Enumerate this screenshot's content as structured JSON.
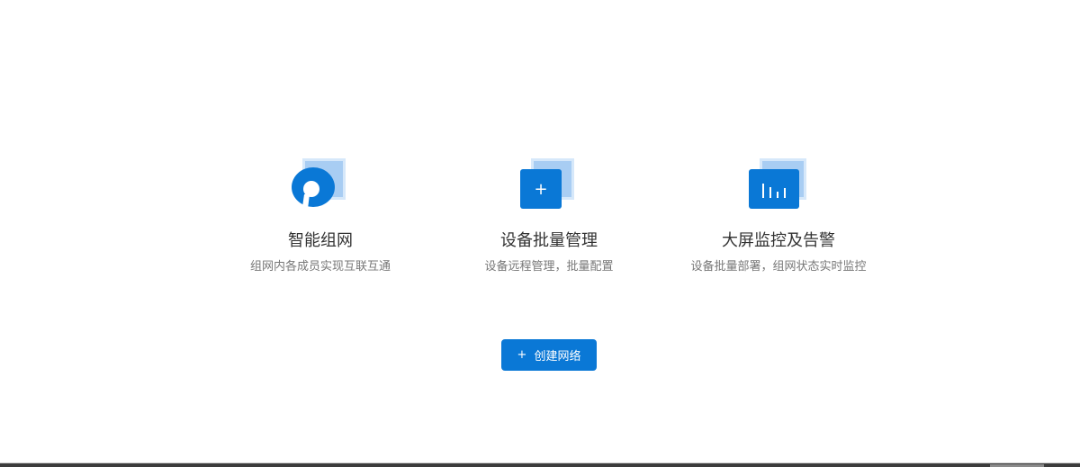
{
  "features": [
    {
      "title": "智能组网",
      "subtitle": "组网内各成员实现互联互通",
      "icon": "network-ring-icon"
    },
    {
      "title": "设备批量管理",
      "subtitle": "设备远程管理，批量配置",
      "icon": "plus-icon",
      "glyph": "+"
    },
    {
      "title": "大屏监控及告警",
      "subtitle": "设备批量部署，组网状态实时监控",
      "icon": "bar-chart-icon"
    }
  ],
  "create_button": {
    "icon": "+",
    "label": "创建网络"
  },
  "colors": {
    "accent": "#0a78d6",
    "accent_light": "#a8cdf3"
  }
}
